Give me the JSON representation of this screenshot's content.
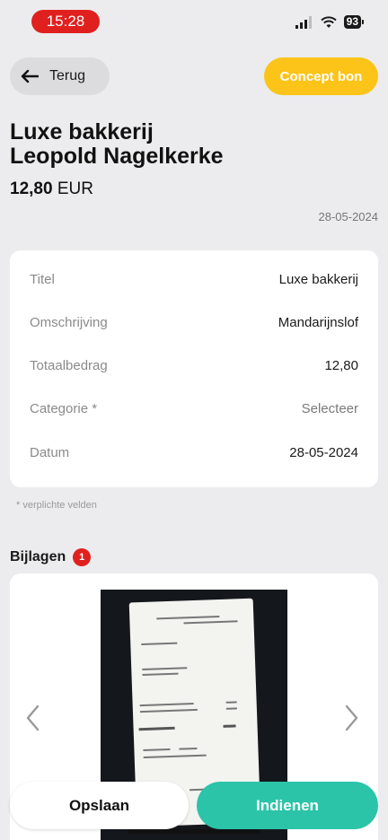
{
  "status_bar": {
    "time": "15:28",
    "battery": "93"
  },
  "header": {
    "back_label": "Terug",
    "concept_label": "Concept bon"
  },
  "receipt": {
    "title_line1": "Luxe bakkerij",
    "title_line2": "Leopold Nagelkerke",
    "amount_value": "12,80",
    "amount_currency": "EUR",
    "date": "28-05-2024"
  },
  "details": [
    {
      "label": "Titel",
      "value": "Luxe bakkerij"
    },
    {
      "label": "Omschrijving",
      "value": "Mandarijnslof"
    },
    {
      "label": "Totaalbedrag",
      "value": "12,80"
    },
    {
      "label": "Categorie *",
      "value": "Selecteer"
    },
    {
      "label": "Datum",
      "value": "28-05-2024"
    }
  ],
  "required_note": "* verplichte velden",
  "attachments": {
    "label": "Bijlagen",
    "count": "1"
  },
  "actions": {
    "save_label": "Opslaan",
    "submit_label": "Indienen"
  },
  "colors": {
    "accent_red": "#e0201f",
    "concept_yellow": "#fcc419",
    "submit_teal": "#2bc4a8"
  }
}
